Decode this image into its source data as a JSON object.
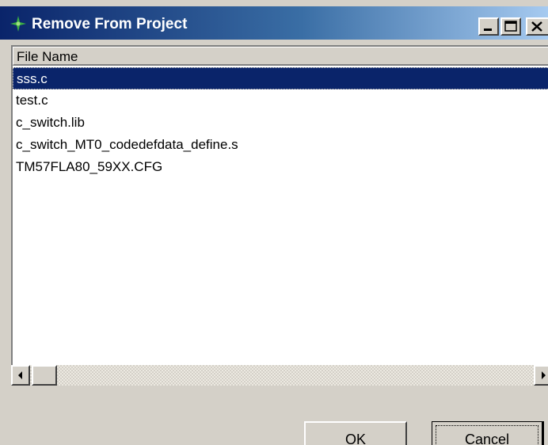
{
  "window": {
    "title": "Remove From Project",
    "controls": {
      "minimize_icon": "minimize-icon",
      "maximize_icon": "maximize-icon",
      "close_icon": "close-icon"
    }
  },
  "list": {
    "column_header": "File Name",
    "selected_index": 0,
    "items": [
      "sss.c",
      "test.c",
      "c_switch.lib",
      "c_switch_MT0_codedefdata_define.s",
      "TM57FLA80_59XX.CFG"
    ]
  },
  "buttons": {
    "ok_label": "OK",
    "cancel_label": "Cancel"
  },
  "colors": {
    "title_bar_start": "#0a246a",
    "title_bar_end": "#a6caf0",
    "selection": "#0a246a",
    "face": "#d4d0c8"
  }
}
